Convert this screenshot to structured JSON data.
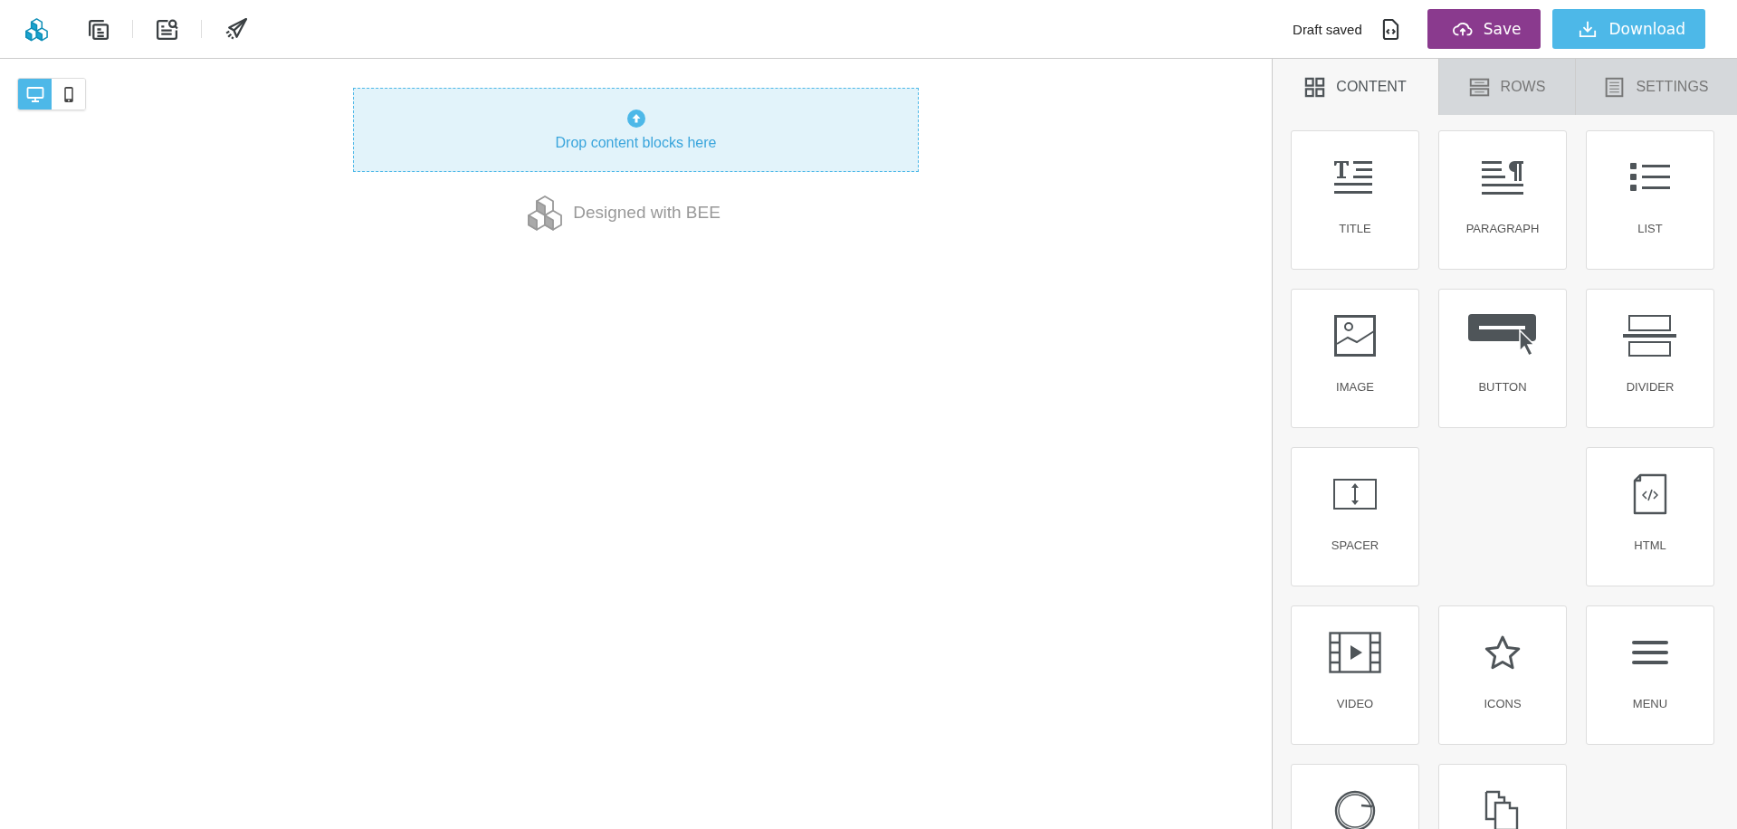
{
  "toolbar": {
    "status": "Draft saved",
    "buttons": [
      {
        "kind": "save",
        "label": "Save"
      },
      {
        "kind": "download",
        "label": "Download"
      }
    ]
  },
  "device_toggle": [
    {
      "kind": "desktop",
      "selected": true
    },
    {
      "kind": "mobile",
      "selected": false
    }
  ],
  "canvas": {
    "drop_zone": "Drop content blocks here",
    "credit": "Designed with BEE"
  },
  "sidebar": {
    "tabs": [
      {
        "kind": "content",
        "label": "CONTENT",
        "selected": true
      },
      {
        "kind": "rows",
        "label": "ROWS",
        "selected": false
      },
      {
        "kind": "settings",
        "label": "SETTINGS",
        "selected": false
      }
    ],
    "block_rows": [
      [
        {
          "kind": "title",
          "label": "TITLE"
        },
        {
          "kind": "paragraph",
          "label": "PARAGRAPH"
        },
        {
          "kind": "list",
          "label": "LIST"
        }
      ],
      [
        {
          "kind": "image",
          "label": "IMAGE"
        },
        {
          "kind": "button",
          "label": "BUTTON"
        },
        {
          "kind": "divider",
          "label": "DIVIDER"
        }
      ],
      [
        {
          "kind": "spacer",
          "label": "SPACER"
        },
        null,
        {
          "kind": "html",
          "label": "HTML"
        }
      ],
      [
        {
          "kind": "video",
          "label": "VIDEO"
        },
        {
          "kind": "icons",
          "label": "ICONS"
        },
        {
          "kind": "menu",
          "label": "MENU"
        }
      ],
      [
        {
          "kind": "social"
        },
        {
          "kind": "pages"
        }
      ]
    ]
  }
}
